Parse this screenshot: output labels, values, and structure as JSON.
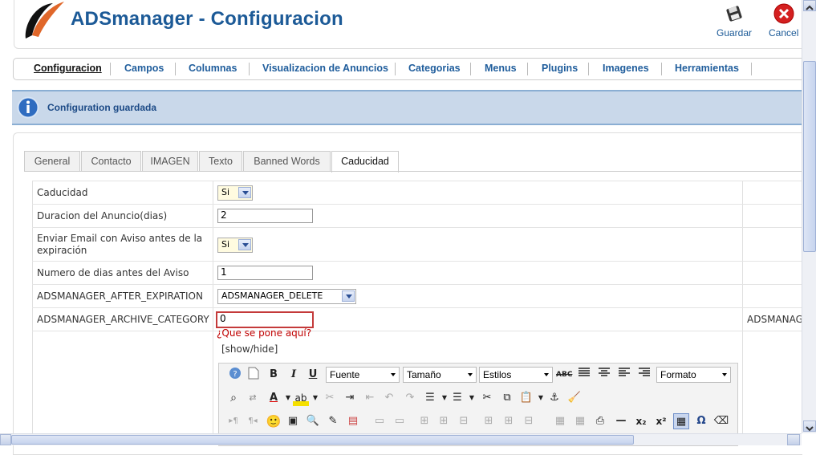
{
  "header": {
    "title": "ADSmanager - Configuracion",
    "save_label": "Guardar",
    "cancel_label": "Cancel"
  },
  "menu": {
    "items": [
      "Configuracion",
      "Campos",
      "Columnas",
      "Visualizacion de Anuncios",
      "Categorias",
      "Menus",
      "Plugins",
      "Imagenes",
      "Herramientas"
    ],
    "active": "Configuracion"
  },
  "message": {
    "text": "Configuration guardada"
  },
  "tabs": {
    "items": [
      "General",
      "Contacto",
      "IMAGEN",
      "Texto",
      "Banned Words",
      "Caducidad"
    ],
    "active": "Caducidad"
  },
  "settings": {
    "caducidad": {
      "label": "Caducidad",
      "value": "Si"
    },
    "duracion": {
      "label": "Duracion del Anuncio(dias)",
      "value": "2"
    },
    "enviar_email": {
      "label_line1": "Enviar Email con Aviso antes de la",
      "label_line2": "expiración",
      "value": "Si"
    },
    "numero_dias": {
      "label": "Numero de dias antes del Aviso",
      "value": "1"
    },
    "after_expiration": {
      "label": "ADSMANAGER_AFTER_EXPIRATION",
      "value": "ADSMANAGER_DELETE"
    },
    "archive_category": {
      "label": "ADSMANAGER_ARCHIVE_CATEGORY",
      "value": "0",
      "note": "¿Que se pone aquí?",
      "right_text": "ADSMANAGI"
    },
    "show_hide": "[show/hide]"
  },
  "editor": {
    "font_label": "Fuente",
    "size_label": "Tamaño",
    "styles_label": "Estilos",
    "format_label": "Formato"
  },
  "colors": {
    "brand_blue": "#1c5a97",
    "message_bg": "#c9d8ea",
    "error_red": "#cc0000"
  }
}
